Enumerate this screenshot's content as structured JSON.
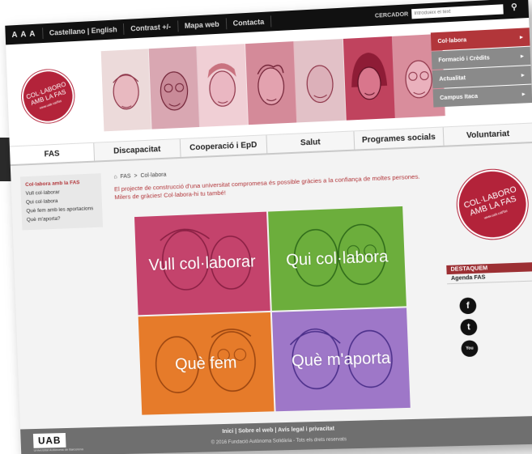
{
  "topbar": {
    "text_size": "A A A",
    "languages": "Castellano | English",
    "contrast": "Contrast +/-",
    "sitemap": "Mapa web",
    "contact": "Contacta",
    "search_label": "CERCADOR",
    "search_placeholder": "Introdueix el text"
  },
  "header": {
    "seal_line1": "COL·LABORO",
    "seal_line2": "AMB LA FAS",
    "seal_url": "www.uab.cat/fas",
    "right_menu": [
      {
        "label": "Col·labora"
      },
      {
        "label": "Formació i Crèdits"
      },
      {
        "label": "Actualitat"
      },
      {
        "label": "Campus Itaca"
      }
    ]
  },
  "nav": {
    "tabs": [
      "FAS",
      "Discapacitat",
      "Cooperació i EpD",
      "Salut",
      "Programes socials",
      "Voluntariat"
    ]
  },
  "sidebar": {
    "items": [
      "Col·labora amb la FAS",
      "Vull col·laborar",
      "Qui col·labora",
      "Què fem amb les aportacions",
      "Què m'aporta?"
    ]
  },
  "main": {
    "breadcrumb_home": "FAS",
    "breadcrumb_sep": ">",
    "breadcrumb_current": "Col·labora",
    "intro": "El projecte de construcció d'una universitat compromesa és possible gràcies a la confiança de moltes persones. Milers de gràcies! Col·labora-hi tu també!",
    "tiles": [
      {
        "label": "Vull col·laborar",
        "color": "#c4436c"
      },
      {
        "label": "Qui col·labora",
        "color": "#6cae3c"
      },
      {
        "label": "Què fem",
        "color": "#e67b2a"
      },
      {
        "label": "Què m'aporta",
        "color": "#9e77c8"
      }
    ]
  },
  "right": {
    "seal_line1": "COL·LABORO",
    "seal_line2": "AMB LA FAS",
    "seal_url": "www.uab.cat/fas",
    "destaquem_title": "DESTAQUEM",
    "destaquem_link": "Agenda FAS",
    "social": [
      "facebook-icon",
      "twitter-icon",
      "youtube-icon"
    ]
  },
  "footer": {
    "logo": "UAB",
    "logo_sub": "Universitat Autònoma de Barcelona",
    "links": "Inici  |  Sobre el web  |  Avís legal i privacitat",
    "copyright": "© 2016 Fundació Autònoma Solidària - Tots els drets reservats"
  },
  "colors": {
    "accent": "#b2363a",
    "topbar": "#111111",
    "footer": "#6f6f6f"
  }
}
